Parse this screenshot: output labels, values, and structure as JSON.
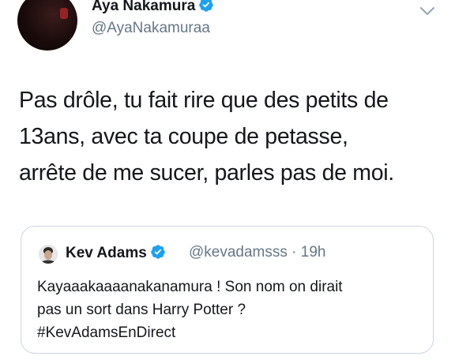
{
  "tweet": {
    "author": {
      "display_name": "Aya Nakamura",
      "handle": "@AyaNakamuraa",
      "verified": true,
      "avatar_icon": "profile-photo"
    },
    "menu_icon": "chevron-down-icon",
    "text_lines": [
      "Pas drôle, tu fait rire que des petits de",
      "13ans, avec ta coupe de petasse,",
      "arrête de me sucer, parles pas de moi."
    ]
  },
  "quoted_tweet": {
    "author": {
      "display_name": "Kev Adams",
      "handle": "@kevadamsss",
      "verified": true,
      "avatar_icon": "profile-photo"
    },
    "meta": "· 19h",
    "text_lines": [
      "Kayaaakaaaanakanamura ! Son nom on dirait",
      "pas un sort dans Harry Potter ?",
      "#KevAdamsEnDirect"
    ]
  },
  "colors": {
    "verified_blue": "#1da1f2",
    "secondary_text": "#657786",
    "card_border": "#ccd6dd"
  }
}
